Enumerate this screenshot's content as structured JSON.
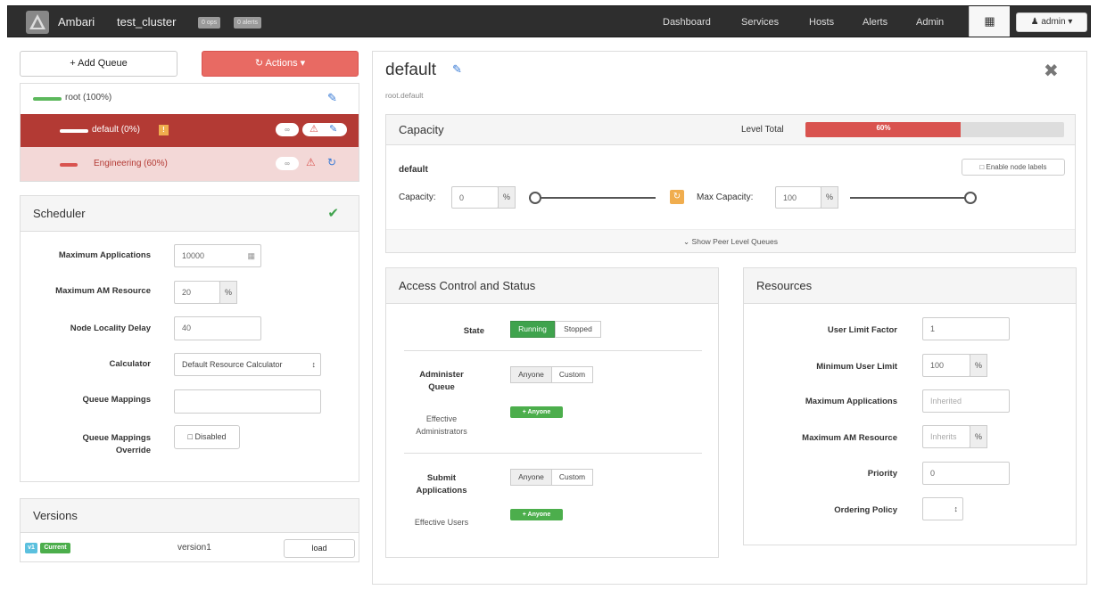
{
  "navbar": {
    "brand": "Ambari",
    "cluster_name": "test_cluster",
    "ops_badge": "0 ops",
    "alerts_badge": "0 alerts",
    "items": [
      "Dashboard",
      "Services",
      "Hosts",
      "Alerts",
      "Admin"
    ],
    "user_label": "admin"
  },
  "toolbar": {
    "add_queue_label": "+ Add Queue",
    "actions_label": "Actions"
  },
  "queue_tree": {
    "root_label": "root (100%)",
    "default_label": "default (0%)",
    "default_warning": "!",
    "engineering_label": "Engineering (60%)"
  },
  "scheduler": {
    "title": "Scheduler",
    "max_apps_label": "Maximum Applications",
    "max_apps_value": "10000",
    "max_am_label": "Maximum AM Resource",
    "max_am_value": "20",
    "max_am_unit": "%",
    "node_locality_label": "Node Locality Delay",
    "node_locality_value": "40",
    "calculator_label": "Calculator",
    "calculator_value": "Default Resource Calculator",
    "queue_mappings_label": "Queue Mappings",
    "queue_mappings_value": "",
    "override_label_1": "Queue Mappings",
    "override_label_2": "Override",
    "override_value": "Disabled"
  },
  "versions": {
    "title": "Versions",
    "badge_v": "v1",
    "badge_current": "Current",
    "name": "version1",
    "load_label": "load"
  },
  "queue_detail": {
    "title": "default",
    "path": "root.default"
  },
  "capacity": {
    "title": "Capacity",
    "level_total_label": "Level Total",
    "level_total_value": "60%",
    "level_total_fraction": 0.6,
    "queue_name": "default",
    "enable_node_labels": "Enable node labels",
    "capacity_label": "Capacity:",
    "capacity_value": "0",
    "capacity_unit": "%",
    "capacity_slider_fraction": 0,
    "max_capacity_label": "Max Capacity:",
    "max_capacity_value": "100",
    "max_capacity_unit": "%",
    "max_capacity_slider_fraction": 1,
    "show_peer": "Show Peer Level Queues"
  },
  "access": {
    "title": "Access Control and Status",
    "state_label": "State",
    "state_running": "Running",
    "state_stopped": "Stopped",
    "administer_label_1": "Administer",
    "administer_label_2": "Queue",
    "anyone": "Anyone",
    "custom": "Custom",
    "effective_admins_1": "Effective",
    "effective_admins_2": "Administrators",
    "anyone_badge": "+ Anyone",
    "submit_label_1": "Submit",
    "submit_label_2": "Applications",
    "effective_users": "Effective Users"
  },
  "resources": {
    "title": "Resources",
    "user_limit_factor_label": "User Limit Factor",
    "user_limit_factor_value": "1",
    "min_user_limit_label": "Minimum User Limit",
    "min_user_limit_value": "100",
    "min_user_limit_unit": "%",
    "max_apps_label": "Maximum Applications",
    "max_apps_placeholder": "Inherited",
    "max_am_label": "Maximum AM Resource",
    "max_am_placeholder": "Inherits",
    "max_am_unit": "%",
    "priority_label": "Priority",
    "priority_value": "0",
    "ordering_policy_label": "Ordering Policy"
  },
  "colors": {
    "navbar": "#2e2e2e",
    "danger": "#d9534f",
    "selected_row": "#b33a34",
    "success": "#3fa34d",
    "link_blue": "#3a7bd5",
    "warning_orange": "#f0ad4e"
  }
}
